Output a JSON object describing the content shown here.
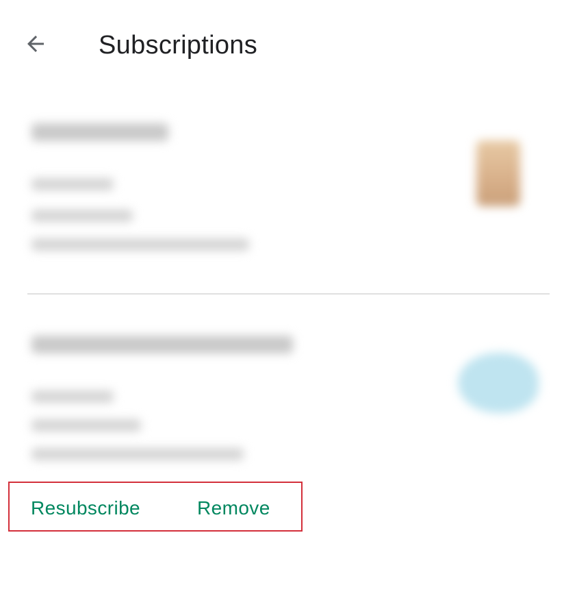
{
  "header": {
    "back_icon": "arrow-left-icon",
    "title": "Subscriptions"
  },
  "subscriptions": [
    {
      "thumbnail": "cup-image",
      "thumbnail_color": "#d8b08a"
    },
    {
      "thumbnail": "blue-blob-image",
      "thumbnail_color": "#bfe4f0"
    }
  ],
  "actions": {
    "resubscribe_label": "Resubscribe",
    "remove_label": "Remove",
    "accent_color": "#01875f",
    "highlight_color": "#d32f3a"
  }
}
